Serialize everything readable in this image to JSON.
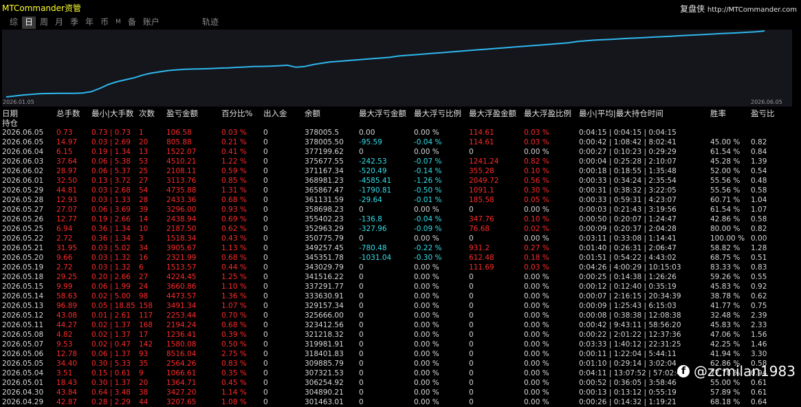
{
  "header": {
    "app_title": "MTCommander资管",
    "brand_name": "复盘侠",
    "brand_url": "http://MTCommander.com"
  },
  "nav": [
    {
      "label": "综",
      "active": false,
      "small": false
    },
    {
      "label": "日",
      "active": true,
      "small": false
    },
    {
      "label": "周",
      "active": false,
      "small": false
    },
    {
      "label": "月",
      "active": false,
      "small": false
    },
    {
      "label": "季",
      "active": false,
      "small": false
    },
    {
      "label": "年",
      "active": false,
      "small": false
    },
    {
      "label": "币",
      "active": false,
      "small": false
    },
    {
      "label": "M",
      "active": false,
      "small": true
    },
    {
      "label": "备",
      "active": false,
      "small": false
    },
    {
      "label": "账户",
      "active": false,
      "small": false
    },
    {
      "label": "轨迹",
      "active": false,
      "small": false,
      "gap": true
    }
  ],
  "chart_data": {
    "type": "line",
    "x_start_label": "2026.01.05",
    "x_end_label": "2026.06.05",
    "values": [
      0,
      1.5,
      3,
      4,
      5,
      5.2,
      5.4,
      5.5,
      5.5,
      6,
      8,
      13,
      19,
      23,
      26,
      29,
      33,
      36,
      38,
      40,
      41,
      42,
      42.3,
      42.6,
      43,
      43.6,
      44,
      44.8,
      45.3,
      46,
      46.3,
      46.7,
      47.3,
      48,
      45,
      46,
      49,
      51,
      53,
      54,
      55,
      56,
      57,
      58,
      59,
      60,
      62,
      63,
      64,
      65,
      66,
      67,
      68,
      69,
      70,
      71,
      72,
      73,
      74,
      75,
      76,
      77,
      78,
      79,
      80,
      81,
      82,
      84,
      85,
      86,
      86.7,
      87.3,
      88,
      88.7,
      89.3,
      90,
      90.7,
      91.3,
      92,
      92.7,
      93.3,
      94,
      94.7,
      95.3,
      96,
      96.7,
      97.3,
      98,
      98.7,
      100
    ],
    "line_color": "#2fb8ef",
    "background_color": "#14161b"
  },
  "table": {
    "columns": [
      "日期",
      "总手数",
      "最小|大手数",
      "次数",
      "盈亏金额",
      "百分比%",
      "出入金",
      "余额",
      "最大浮亏金额",
      "最大浮亏比例",
      "最大浮盈金额",
      "最大浮盈比例",
      "最小|平均|最大持仓时间",
      "胜率",
      "盈亏比"
    ],
    "holding_label": "持仓",
    "rows": [
      [
        "2026.06.05",
        "0.73",
        "0.73 | 0.73",
        "1",
        "106.58",
        "0.03 %",
        "0",
        "378005.5",
        "0.00",
        "0.00 %",
        "114.61",
        "0.03 %",
        "0:04:15 | 0:04:15 | 0:04:15",
        "",
        ""
      ],
      [
        "2026.06.05",
        "14.97",
        "0.03 | 2.69",
        "20",
        "805.88",
        "0.21 %",
        "0",
        "378005.50",
        "-95.59",
        "-0.04 %",
        "114.61",
        "0.03 %",
        "0:00:42 | 1:08:42 | 8:02:41",
        "45.00 %",
        "0.82"
      ],
      [
        "2026.06.04",
        "6.15",
        "0.19 | 1.34",
        "13",
        "1522.07",
        "0.41 %",
        "0",
        "377199.62",
        "0",
        "0.00 %",
        "0",
        "0.00 %",
        "0:00:27 | 0:10:23 | 0:29:29",
        "61.54 %",
        "0.84"
      ],
      [
        "2026.06.03",
        "37.64",
        "0.06 | 5.38",
        "53",
        "4510.21",
        "1.22 %",
        "0",
        "375677.55",
        "-242.53",
        "-0.07 %",
        "1241.24",
        "0.82 %",
        "0:00:04 | 0:25:28 | 2:10:07",
        "45.28 %",
        "1.39"
      ],
      [
        "2026.06.02",
        "28.97",
        "0.06 | 5.37",
        "25",
        "2108.11",
        "0.59 %",
        "0",
        "371167.34",
        "-520.49",
        "-0.14 %",
        "355.28",
        "0.10 %",
        "0:00:18 | 0:18:55 | 1:35:48",
        "52.00 %",
        "0.54"
      ],
      [
        "2026.06.01",
        "32.50",
        "0.13 | 3.72",
        "27",
        "3113.76",
        "0.85 %",
        "0",
        "368981.23",
        "-4585.41",
        "-1.26 %",
        "2049.72",
        "0.56 %",
        "0:00:33 | 0:34:24 | 2:35:54",
        "55.56 %",
        "0.48"
      ],
      [
        "2026.05.29",
        "44.81",
        "0.03 | 2.68",
        "54",
        "4735.88",
        "1.31 %",
        "0",
        "365867.47",
        "-1790.81",
        "-0.50 %",
        "1091.1",
        "0.30 %",
        "0:00:31 | 0:38:32 | 3:22:05",
        "55.56 %",
        "0.58"
      ],
      [
        "2026.05.28",
        "12.93",
        "0.03 | 1.33",
        "28",
        "2433.36",
        "0.68 %",
        "0",
        "361131.59",
        "-29.64",
        "-0.01 %",
        "185.58",
        "0.05 %",
        "0:00:33 | 0:59:31 | 4:23:07",
        "60.71 %",
        "1.04"
      ],
      [
        "2026.05.27",
        "27.07",
        "0.06 | 3.69",
        "39",
        "3296.00",
        "0.93 %",
        "0",
        "358698.23",
        "0",
        "0.00 %",
        "0",
        "0.00 %",
        "0:00:03 | 0:21:43 | 3:19:56",
        "61.54 %",
        "1.07"
      ],
      [
        "2026.05.26",
        "12.77",
        "0.19 | 2.66",
        "14",
        "2438.94",
        "0.69 %",
        "0",
        "355402.23",
        "-136.8",
        "-0.04 %",
        "347.76",
        "0.10 %",
        "0:00:50 | 0:20:07 | 1:24:47",
        "42.86 %",
        "0.58"
      ],
      [
        "2026.05.25",
        "6.94",
        "0.36 | 1.34",
        "10",
        "2187.50",
        "0.62 %",
        "0",
        "352963.29",
        "-327.96",
        "-0.09 %",
        "76.68",
        "0.02 %",
        "0:00:09 | 0:20:37 | 2:04:28",
        "80.00 %",
        "0.82"
      ],
      [
        "2026.05.22",
        "2.72",
        "0.36 | 1.34",
        "3",
        "1518.34",
        "0.43 %",
        "0",
        "350775.79",
        "0",
        "0.00 %",
        "0",
        "0.00 %",
        "0:03:11 | 0:33:08 | 1:14:41",
        "100.00 %",
        "0.00"
      ],
      [
        "2026.05.21",
        "31.95",
        "0.03 | 5.02",
        "34",
        "3905.67",
        "1.13 %",
        "0",
        "349257.45",
        "-780.48",
        "-0.22 %",
        "931.2",
        "0.27 %",
        "0:01:40 | 0:26:31 | 2:06:47",
        "58.82 %",
        "1.28"
      ],
      [
        "2026.05.20",
        "9.66",
        "0.03 | 1.32",
        "16",
        "2321.99",
        "0.68 %",
        "0",
        "345351.78",
        "-1031.04",
        "-0.30 %",
        "612.48",
        "0.18 %",
        "0:01:51 | 0:54:22 | 4:43:02",
        "68.75 %",
        "0.51"
      ],
      [
        "2026.05.19",
        "2.72",
        "0.03 | 1.32",
        "6",
        "1513.57",
        "0.44 %",
        "0",
        "343029.79",
        "0",
        "0.00 %",
        "111.69",
        "0.03 %",
        "0:04:26 | 4:00:29 | 10:15:03",
        "83.33 %",
        "0.83"
      ],
      [
        "2026.05.18",
        "29.25",
        "0.20 | 2.66",
        "27",
        "4224.45",
        "1.25 %",
        "0",
        "341516.22",
        "0",
        "0.00 %",
        "0",
        "0.00 %",
        "0:00:25 | 0:14:38 | 1:26:26",
        "59.26 %",
        "0.55"
      ],
      [
        "2026.05.15",
        "9.99",
        "0.06 | 1.99",
        "24",
        "3660.86",
        "1.10 %",
        "0",
        "337291.77",
        "0",
        "0.00 %",
        "0",
        "0.00 %",
        "0:00:12 | 0:12:40 | 0:35:19",
        "45.83 %",
        "0.92"
      ],
      [
        "2026.05.14",
        "58.63",
        "0.02 | 5.00",
        "98",
        "4473.57",
        "1.36 %",
        "0",
        "333630.91",
        "0",
        "0.00 %",
        "0",
        "0.00 %",
        "0:00:07 | 2:16:15 | 20:34:39",
        "38.78 %",
        "0.62"
      ],
      [
        "2026.05.13",
        "96.89",
        "0.05 | 18.85",
        "158",
        "3491.34",
        "1.07 %",
        "0",
        "329157.34",
        "0",
        "0.00 %",
        "0",
        "0.00 %",
        "0:00:09 | 1:25:43 | 6:15:03",
        "41.77 %",
        "0.75"
      ],
      [
        "2026.05.12",
        "43.08",
        "0.01 | 2.61",
        "117",
        "2253.44",
        "0.70 %",
        "0",
        "325666.00",
        "0",
        "0.00 %",
        "0",
        "0.00 %",
        "0:00:08 | 0:38:38 | 12:08:38",
        "32.48 %",
        "2.39"
      ],
      [
        "2026.05.11",
        "44.27",
        "0.02 | 1.37",
        "168",
        "2194.24",
        "0.68 %",
        "0",
        "323412.56",
        "0",
        "0.00 %",
        "0",
        "0.00 %",
        "0:00:42 | 9:43:11 | 58:56:20",
        "45.83 %",
        "2.33"
      ],
      [
        "2026.05.08",
        "4.82",
        "0.02 | 1.37",
        "17",
        "1236.41",
        "0.39 %",
        "0",
        "321218.32",
        "0",
        "0.00 %",
        "0",
        "0.00 %",
        "0:00:22 | 2:01:22 | 12:37:36",
        "47.06 %",
        "1.56"
      ],
      [
        "2026.05.07",
        "9.53",
        "0.02 | 0.47",
        "142",
        "1580.08",
        "0.50 %",
        "0",
        "319981.91",
        "0",
        "0.00 %",
        "0",
        "0.00 %",
        "0:03:33 | 1:40:12 | 22:31:25",
        "42.25 %",
        "1.46"
      ],
      [
        "2026.05.06",
        "12.78",
        "0.06 | 1.37",
        "93",
        "8516.04",
        "2.75 %",
        "0",
        "318401.83",
        "0",
        "0.00 %",
        "0",
        "0.00 %",
        "0:00:11 | 1:22:04 | 5:44:11",
        "41.94 %",
        "3.30"
      ],
      [
        "2026.05.05",
        "34.40",
        "0.30 | 5.33",
        "35",
        "2564.26",
        "0.83 %",
        "0",
        "309885.79",
        "0",
        "0.00 %",
        "0",
        "0.00 %",
        "0:01:10 | 0:29:14 | 3:02:04",
        "62.86 %",
        "0.58"
      ],
      [
        "2026.05.04",
        "3.51",
        "0.15 | 0.61",
        "9",
        "1066.61",
        "0.35 %",
        "0",
        "307321.53",
        "0",
        "0.00 %",
        "0",
        "0.00 %",
        "0:04:11 | 13:07:52 | 57:02:49",
        "77.78 %",
        "0.94"
      ],
      [
        "2026.05.01",
        "18.43",
        "0.30 | 1.37",
        "20",
        "1364.71",
        "0.45 %",
        "0",
        "306254.92",
        "0",
        "0.00 %",
        "0",
        "0.00 %",
        "0:00:52 | 0:36:05 | 3:58:46",
        "55.00 %",
        "0.61"
      ],
      [
        "2026.04.30",
        "43.84",
        "0.64 | 3.48",
        "38",
        "3427.20",
        "1.14 %",
        "0",
        "304890.21",
        "0",
        "0.00 %",
        "0",
        "0.00 %",
        "0:00:13 | 0:13:12 | 0:55:19",
        "57.89 %",
        "0.61"
      ],
      [
        "2026.04.29",
        "42.87",
        "0.28 | 2.29",
        "44",
        "3207.65",
        "1.08 %",
        "0",
        "301463.01",
        "0",
        "0.00 %",
        "0",
        "0.00 %",
        "0:00:26 | 0:14:32 | 1:19:21",
        "68.18 %",
        "0.64"
      ]
    ]
  },
  "watermark": {
    "logo_letter": "f",
    "text": "@zcmilan1983"
  }
}
